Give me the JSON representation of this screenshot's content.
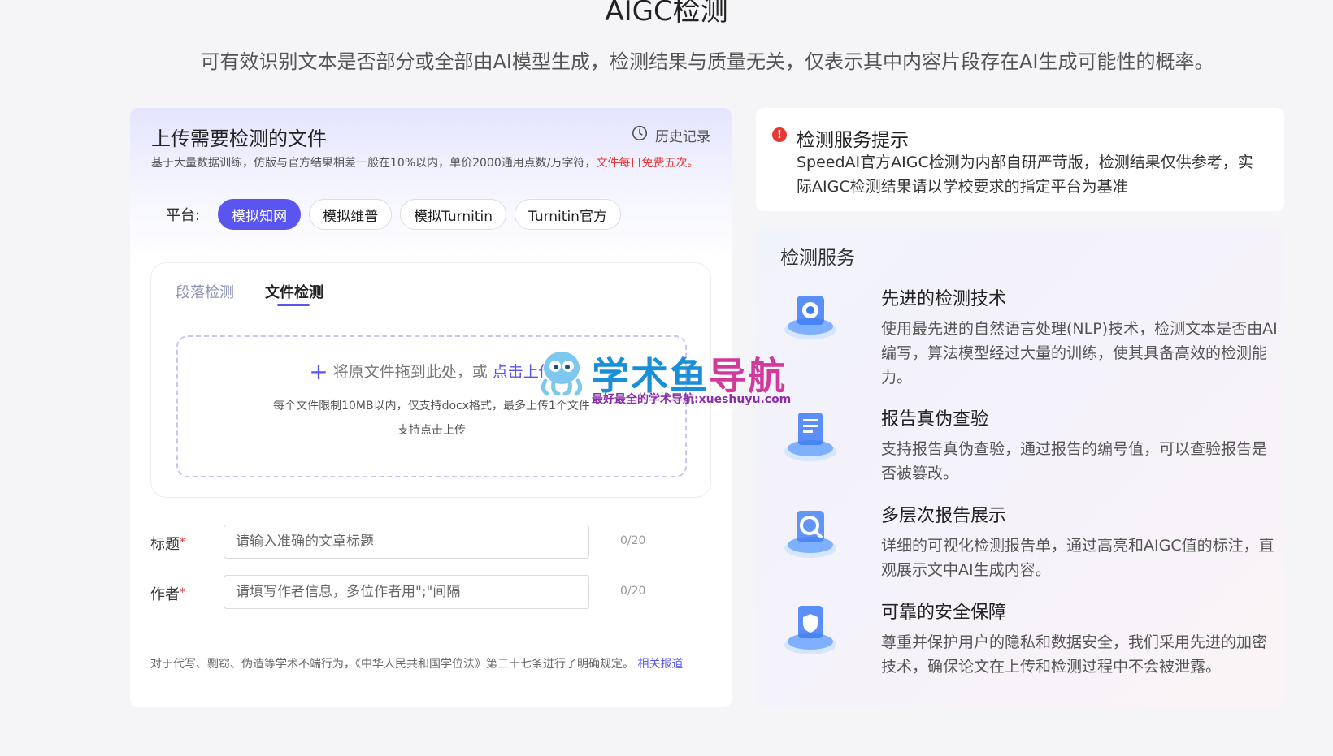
{
  "page": {
    "title": "AIGC检测",
    "subtitle": "可有效识别文本是否部分或全部由AI模型生成，检测结果与质量无关，仅表示其中内容片段存在AI生成可能性的概率。"
  },
  "upload": {
    "title": "上传需要检测的文件",
    "history_label": "历史记录",
    "desc": "基于大量数据训练，仿版与官方结果相差一般在10%以内，单价2000通用点数/万字符，",
    "desc_highlight": "文件每日免费五次。",
    "platform_label": "平台:",
    "platforms": [
      "模拟知网",
      "模拟维普",
      "模拟Turnitin",
      "Turnitin官方"
    ],
    "active_platform": "模拟知网",
    "tabs": [
      "段落检测",
      "文件检测"
    ],
    "active_tab": "文件检测",
    "drop_text": "将原文件拖到此处，或",
    "drop_link": "点击上传",
    "drop_note1": "每个文件限制10MB以内，仅支持docx格式，最多上传1个文件",
    "drop_note2": "支持点击上传",
    "fields": {
      "title_label": "标题",
      "title_placeholder": "请输入准确的文章标题",
      "title_count": "0/20",
      "author_label": "作者",
      "author_placeholder": "请填写作者信息，多位作者用\";\"间隔",
      "author_count": "0/20"
    },
    "legal_note": "对于代写、剽窃、伪造等学术不端行为，《中华人民共和国学位法》第三十七条进行了明确规定。",
    "legal_link": "相关报道"
  },
  "notice": {
    "icon": "alert-icon",
    "title": "检测服务提示",
    "text": "SpeedAI官方AIGC检测为内部自研严苛版，检测结果仅供参考，实际AIGC检测结果请以学校要求的指定平台为基准"
  },
  "services": {
    "title": "检测服务",
    "items": [
      {
        "title": "先进的检测技术",
        "desc": "使用最先进的自然语言处理(NLP)技术，检测文本是否由AI编写，算法模型经过大量的训练，使其具备高效的检测能力。",
        "icon": "gear-icon"
      },
      {
        "title": "报告真伪查验",
        "desc": "支持报告真伪查验，通过报告的编号值，可以查验报告是否被篡改。",
        "icon": "report-icon"
      },
      {
        "title": "多层次报告展示",
        "desc": "详细的可视化检测报告单，通过高亮和AIGC值的标注，直观展示文中AI生成内容。",
        "icon": "magnifier-icon"
      },
      {
        "title": "可靠的安全保障",
        "desc": "尊重并保护用户的隐私和数据安全，我们采用先进的加密技术，确保论文在上传和检测过程中不会被泄露。",
        "icon": "shield-document-icon"
      }
    ]
  },
  "watermark": {
    "text_blue": "学术鱼",
    "text_pink": "导航",
    "sub": "最好最全的学术导航:xueshuyu.com"
  },
  "colors": {
    "accent": "#5b55f0",
    "required": "#e53935",
    "watermark_blue": "#1a8fd8",
    "watermark_pink": "#d13a9c"
  }
}
